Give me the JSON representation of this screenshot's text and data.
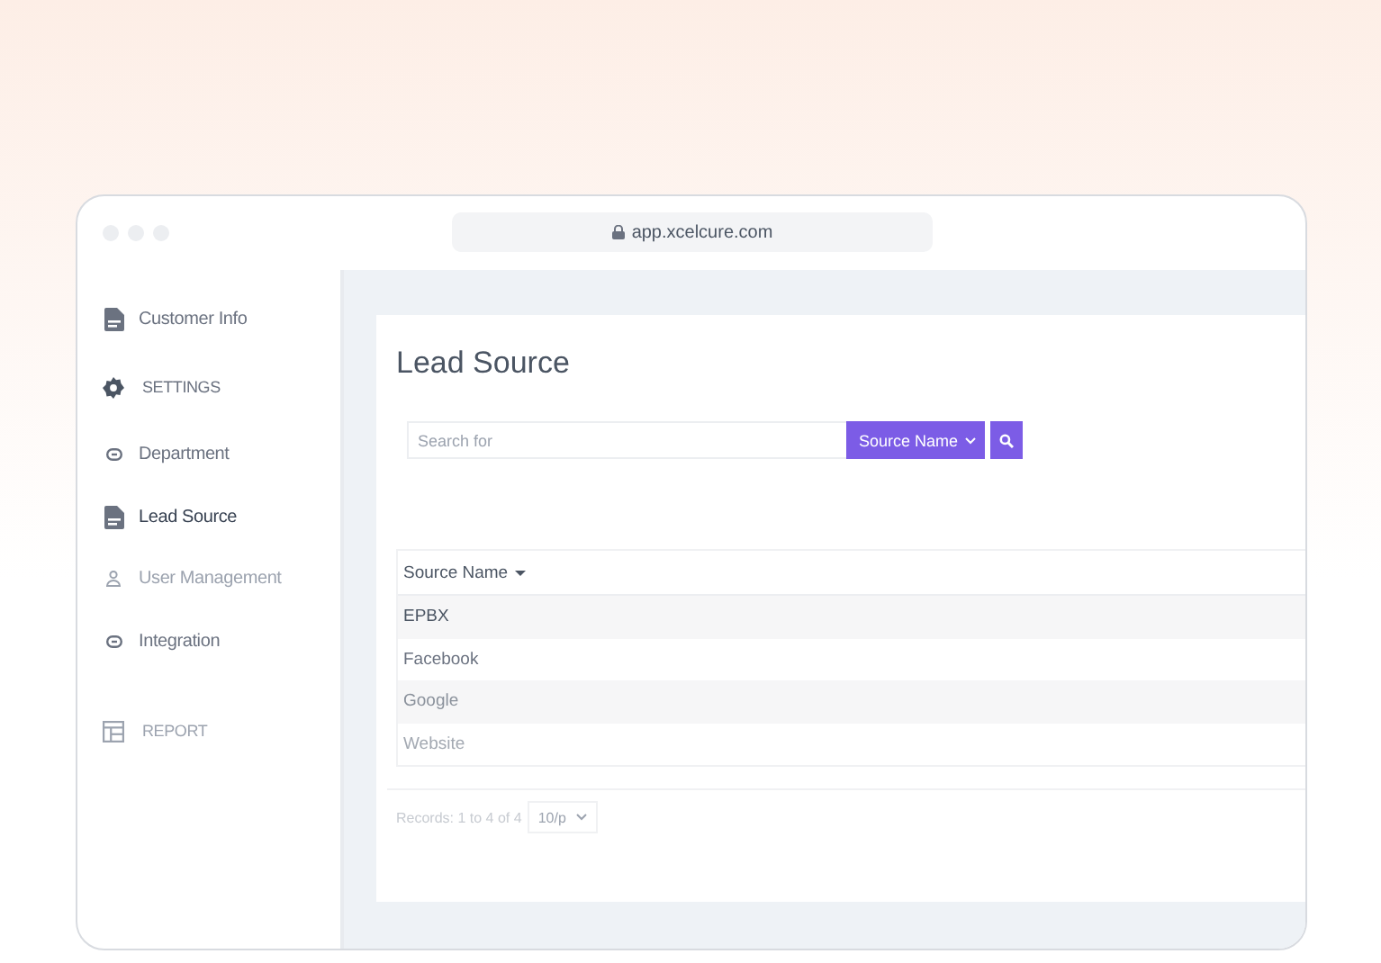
{
  "browser": {
    "address": "app.xcelcure.com"
  },
  "sidebar": {
    "items": [
      {
        "kind": "item",
        "label": "Customer Info",
        "selected": false
      },
      {
        "kind": "section",
        "label": "SETTINGS"
      },
      {
        "kind": "item",
        "label": "Department",
        "selected": false
      },
      {
        "kind": "item",
        "label": "Lead Source",
        "selected": true
      },
      {
        "kind": "item",
        "label": "User Management",
        "selected": false
      },
      {
        "kind": "item",
        "label": "Integration",
        "selected": false
      },
      {
        "kind": "section",
        "label": "REPORT"
      }
    ]
  },
  "page": {
    "title": "Lead Source",
    "search": {
      "placeholder": "Search for",
      "filter": "Source Name"
    },
    "table": {
      "columns": [
        "Source Name"
      ],
      "rows": [
        [
          "EPBX"
        ],
        [
          "Facebook"
        ],
        [
          "Google"
        ],
        [
          "Website"
        ]
      ]
    },
    "footer": {
      "records": "Records: 1 to 4 of 4",
      "page_size": "10/p"
    }
  }
}
